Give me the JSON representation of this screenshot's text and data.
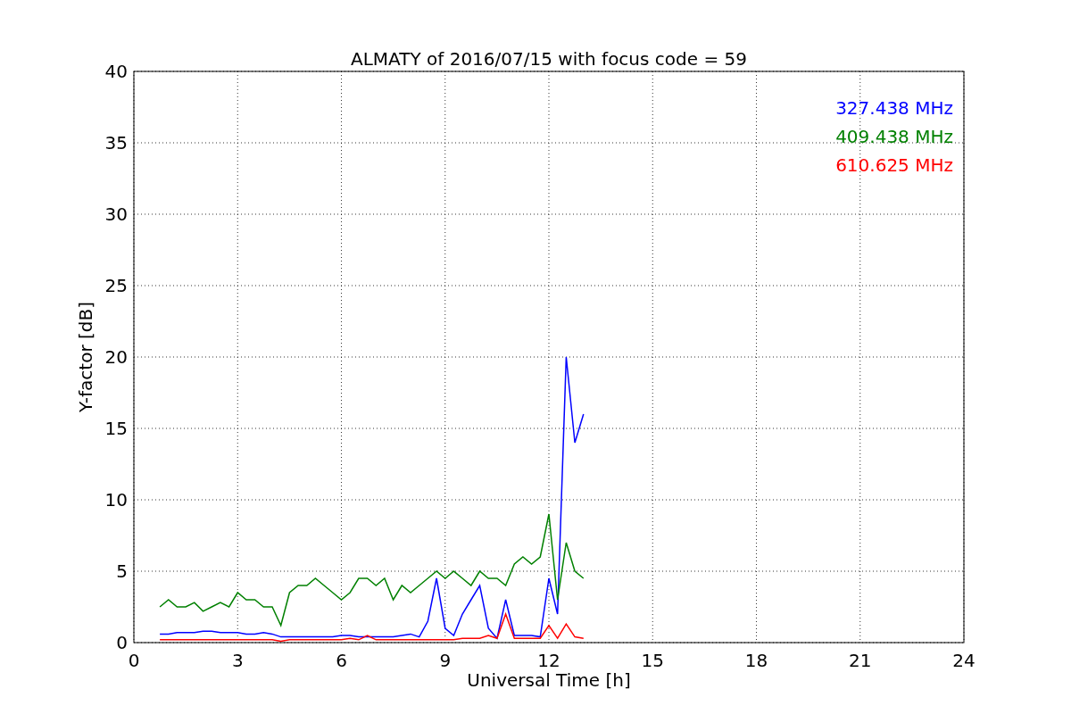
{
  "chart_data": {
    "type": "line",
    "grid": true,
    "title": "ALMATY of 2016/07/15 with focus code = 59",
    "xlabel": "Universal Time [h]",
    "ylabel": "Y-factor [dB]",
    "xlim": [
      0,
      24
    ],
    "ylim": [
      0,
      40
    ],
    "xticks": [
      0,
      3,
      6,
      9,
      12,
      15,
      18,
      21,
      24
    ],
    "yticks": [
      0,
      5,
      10,
      15,
      20,
      25,
      30,
      35,
      40
    ],
    "x": [
      0.75,
      1,
      1.25,
      1.5,
      1.75,
      2,
      2.25,
      2.5,
      2.75,
      3,
      3.25,
      3.5,
      3.75,
      4,
      4.25,
      4.5,
      4.75,
      5,
      5.25,
      5.5,
      5.75,
      6,
      6.25,
      6.5,
      6.75,
      7,
      7.25,
      7.5,
      7.75,
      8,
      8.25,
      8.5,
      8.75,
      9,
      9.25,
      9.5,
      9.75,
      10,
      10.25,
      10.5,
      10.75,
      11,
      11.25,
      11.5,
      11.75,
      12,
      12.25,
      12.5,
      12.75,
      13
    ],
    "series": [
      {
        "name": "327.438 MHz",
        "color": "#0000ff",
        "values": [
          0.6,
          0.6,
          0.7,
          0.7,
          0.7,
          0.8,
          0.8,
          0.7,
          0.7,
          0.7,
          0.6,
          0.6,
          0.7,
          0.6,
          0.4,
          0.4,
          0.4,
          0.4,
          0.4,
          0.4,
          0.4,
          0.5,
          0.5,
          0.4,
          0.4,
          0.4,
          0.4,
          0.4,
          0.5,
          0.6,
          0.4,
          1.5,
          4.5,
          1,
          0.5,
          2,
          3,
          4,
          1,
          0.3,
          3,
          0.5,
          0.5,
          0.5,
          0.4,
          4.5,
          2,
          20,
          14,
          16
        ]
      },
      {
        "name": "409.438 MHz",
        "color": "#008000",
        "values": [
          2.5,
          3,
          2.5,
          2.5,
          2.8,
          2.2,
          2.5,
          2.8,
          2.5,
          3.5,
          3,
          3,
          2.5,
          2.5,
          1.2,
          3.5,
          4,
          4,
          4.5,
          4,
          3.5,
          3,
          3.5,
          4.5,
          4.5,
          4,
          4.5,
          3,
          4,
          3.5,
          4,
          4.5,
          5,
          4.5,
          5,
          4.5,
          4,
          5,
          4.5,
          4.5,
          4,
          5.5,
          6,
          5.5,
          6,
          9,
          3,
          7,
          5,
          4.5
        ]
      },
      {
        "name": "610.625 MHz",
        "color": "#ff0000",
        "values": [
          0.2,
          0.2,
          0.2,
          0.2,
          0.2,
          0.2,
          0.2,
          0.2,
          0.2,
          0.2,
          0.2,
          0.2,
          0.2,
          0.2,
          0.1,
          0.2,
          0.2,
          0.2,
          0.2,
          0.2,
          0.2,
          0.2,
          0.3,
          0.2,
          0.5,
          0.2,
          0.2,
          0.2,
          0.2,
          0.2,
          0.2,
          0.2,
          0.2,
          0.2,
          0.2,
          0.3,
          0.3,
          0.3,
          0.5,
          0.3,
          2,
          0.3,
          0.3,
          0.3,
          0.3,
          1.2,
          0.3,
          1.3,
          0.4,
          0.3
        ]
      }
    ]
  }
}
